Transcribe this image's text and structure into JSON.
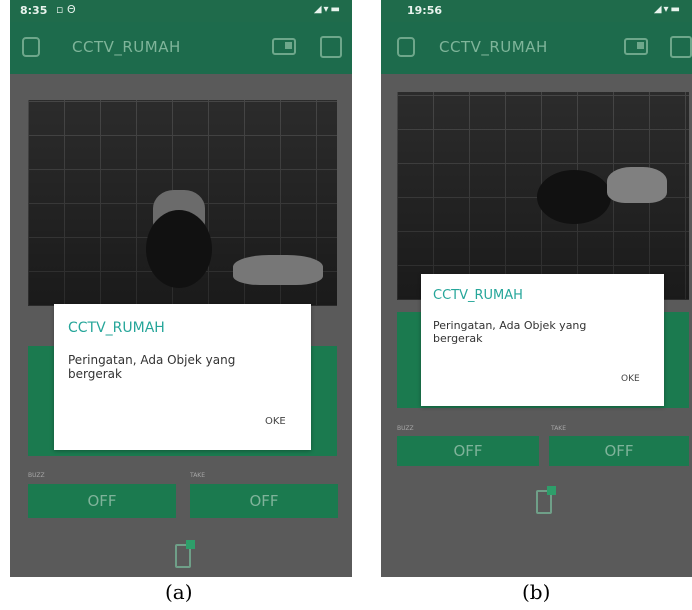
{
  "screen_a": {
    "status_time": "8:35",
    "status_extra": "▫ Θ",
    "status_icons": "◢▾▬",
    "app_title": "CCTV_RUMAH",
    "dialog": {
      "title": "CCTV_RUMAH",
      "message": "Peringatan, Ada Objek yang bergerak",
      "ok": "OKE"
    },
    "labels": {
      "left": "BUZZ",
      "right": "TAKE"
    },
    "buttons": {
      "left": "OFF",
      "right": "OFF"
    },
    "caption": "(a)"
  },
  "screen_b": {
    "status_time": "19:56",
    "status_icons": "◢▾▬",
    "app_title": "CCTV_RUMAH",
    "dialog": {
      "title": "CCTV_RUMAH",
      "message": "Peringatan, Ada Objek yang bergerak",
      "ok": "OKE"
    },
    "labels": {
      "left": "BUZZ",
      "right": "TAKE"
    },
    "buttons": {
      "left": "OFF",
      "right": "OFF"
    },
    "caption": "(b)"
  }
}
